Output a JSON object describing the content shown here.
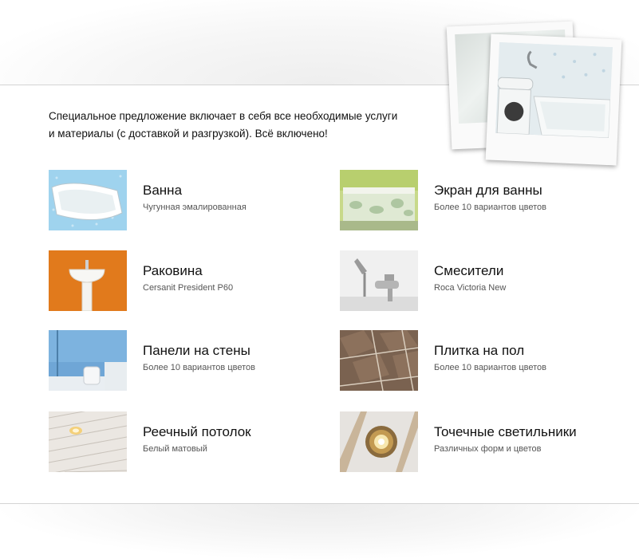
{
  "intro": {
    "line1": "Специальное предложение включает в себя все необходимые услуги",
    "line2": "и материалы (с доставкой и разгрузкой). Всё включено!"
  },
  "items": [
    {
      "title": "Ванна",
      "subtitle": "Чугунная эмалированная"
    },
    {
      "title": "Экран для ванны",
      "subtitle": "Более 10 вариантов цветов"
    },
    {
      "title": "Раковина",
      "subtitle": "Cersanit President P60"
    },
    {
      "title": "Смесители",
      "subtitle": "Roca Victoria New"
    },
    {
      "title": "Панели на стены",
      "subtitle": "Более 10 вариантов цветов"
    },
    {
      "title": "Плитка на пол",
      "subtitle": "Более 10 вариантов цветов"
    },
    {
      "title": "Реечный потолок",
      "subtitle": "Белый матовый"
    },
    {
      "title": "Точечные светильники",
      "subtitle": "Различных форм и цветов"
    }
  ]
}
